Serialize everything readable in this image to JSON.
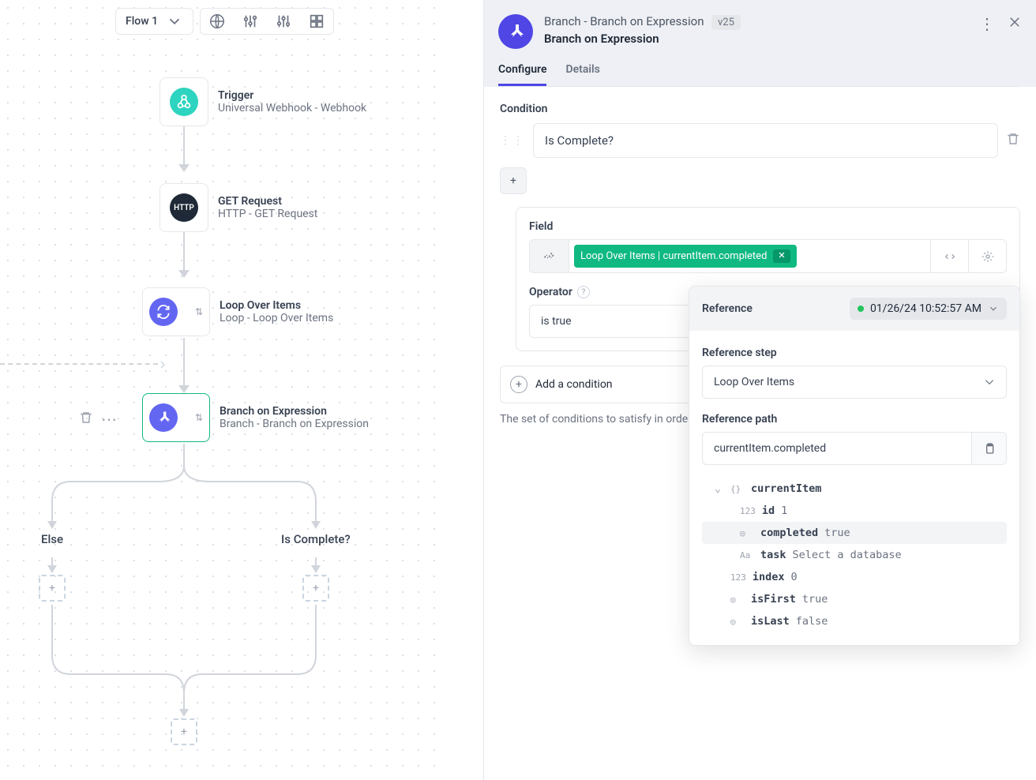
{
  "toolbar": {
    "flow_name": "Flow 1"
  },
  "nodes": {
    "trigger": {
      "title": "Trigger",
      "sub": "Universal Webhook - Webhook"
    },
    "get": {
      "title": "GET Request",
      "sub": "HTTP - GET Request",
      "badge": "HTTP"
    },
    "loop": {
      "title": "Loop Over Items",
      "sub": "Loop - Loop Over Items"
    },
    "branch": {
      "title": "Branch on Expression",
      "sub": "Branch - Branch on Expression"
    }
  },
  "branches": {
    "else": "Else",
    "complete": "Is Complete?"
  },
  "panel": {
    "title_path": "Branch - Branch on Expression",
    "title": "Branch on Expression",
    "version": "v25",
    "tab_configure": "Configure",
    "tab_details": "Details",
    "condition_label": "Condition",
    "condition_value": "Is Complete?",
    "field_label": "Field",
    "chip_text": "Loop Over Items | currentItem.completed",
    "operator_label": "Operator",
    "operator_value": "is true",
    "add_condition": "Add a condition",
    "help": "The set of conditions to satisfy in order t"
  },
  "popover": {
    "title": "Reference",
    "timestamp": "01/26/24 10:52:57 AM",
    "ref_step_label": "Reference step",
    "ref_step_value": "Loop Over Items",
    "ref_path_label": "Reference path",
    "ref_path_value": "currentItem.completed",
    "tree": {
      "root": "currentItem",
      "id_key": "id",
      "id_val": "1",
      "completed_key": "completed",
      "completed_val": "true",
      "task_key": "task",
      "task_val": "Select a database",
      "index_key": "index",
      "index_val": "0",
      "isfirst_key": "isFirst",
      "isfirst_val": "true",
      "islast_key": "isLast",
      "islast_val": "false"
    }
  }
}
